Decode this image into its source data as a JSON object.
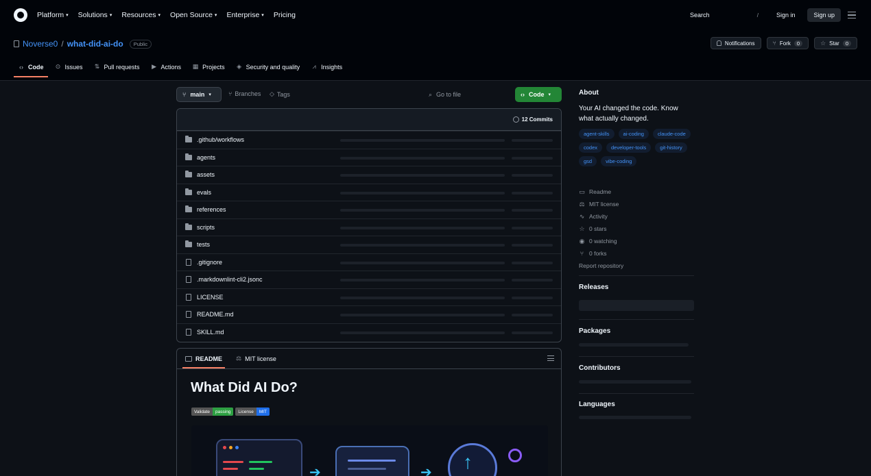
{
  "topnav": {
    "items": [
      {
        "label": "Platform",
        "has_caret": true
      },
      {
        "label": "Solutions",
        "has_caret": true
      },
      {
        "label": "Resources",
        "has_caret": true
      },
      {
        "label": "Open Source",
        "has_caret": true
      },
      {
        "label": "Enterprise",
        "has_caret": true
      },
      {
        "label": "Pricing",
        "has_caret": false
      }
    ],
    "search_label": "Search",
    "search_shortcut": "/",
    "signin_label": "Sign in",
    "signup_label": "Sign up"
  },
  "repo": {
    "owner": "Noverse0",
    "separator": "/",
    "name": "what-did-ai-do",
    "visibility": "Public",
    "notifications_label": "Notifications",
    "fork_label": "Fork",
    "fork_count": "0",
    "star_label": "Star",
    "star_count": "0"
  },
  "repo_tabs": [
    {
      "label": "Code",
      "icon": "code-icon",
      "active": true
    },
    {
      "label": "Issues",
      "icon": "issue-icon",
      "active": false
    },
    {
      "label": "Pull requests",
      "icon": "pull-request-icon",
      "active": false
    },
    {
      "label": "Actions",
      "icon": "play-icon",
      "active": false
    },
    {
      "label": "Projects",
      "icon": "table-icon",
      "active": false
    },
    {
      "label": "Security and quality",
      "icon": "shield-icon",
      "active": false
    },
    {
      "label": "Insights",
      "icon": "graph-icon",
      "active": false
    }
  ],
  "toolbar": {
    "branch": "main",
    "branches_label": "Branches",
    "tags_label": "Tags",
    "goto_placeholder": "Go to file",
    "code_label": "Code"
  },
  "commits": {
    "label": "12 Commits"
  },
  "files": [
    {
      "name": ".github/workflows",
      "type": "folder"
    },
    {
      "name": "agents",
      "type": "folder"
    },
    {
      "name": "assets",
      "type": "folder"
    },
    {
      "name": "evals",
      "type": "folder"
    },
    {
      "name": "references",
      "type": "folder"
    },
    {
      "name": "scripts",
      "type": "folder"
    },
    {
      "name": "tests",
      "type": "folder"
    },
    {
      "name": ".gitignore",
      "type": "file"
    },
    {
      "name": ".markdownlint-cli2.jsonc",
      "type": "file"
    },
    {
      "name": "LICENSE",
      "type": "file"
    },
    {
      "name": "README.md",
      "type": "file"
    },
    {
      "name": "SKILL.md",
      "type": "file"
    }
  ],
  "readme": {
    "tab_readme": "README",
    "tab_license": "MIT license",
    "title": "What Did AI Do?",
    "badges": [
      {
        "left": "Validate",
        "right": "passing",
        "color": "#2ea043"
      },
      {
        "left": "License",
        "right": "MIT",
        "color": "#1f6feb"
      }
    ]
  },
  "about": {
    "heading": "About",
    "description": "Your AI changed the code. Know what actually changed.",
    "topics": [
      "agent-skills",
      "ai-coding",
      "claude-code",
      "codex",
      "developer-tools",
      "git-history",
      "gsd",
      "vibe-coding"
    ],
    "meta": [
      {
        "label": "Readme",
        "icon": "book-icon"
      },
      {
        "label": "MIT license",
        "icon": "law-icon"
      },
      {
        "label": "Activity",
        "icon": "pulse-icon"
      },
      {
        "label": "0 stars",
        "icon": "star-icon"
      },
      {
        "label": "0 watching",
        "icon": "eye-icon"
      },
      {
        "label": "0 forks",
        "icon": "fork-icon"
      }
    ],
    "report_label": "Report repository"
  },
  "sidebar_sections": {
    "releases": "Releases",
    "packages": "Packages",
    "contributors": "Contributors",
    "languages": "Languages"
  },
  "colors": {
    "background": "#0d1117",
    "header": "#010409",
    "accent_link": "#4493f8",
    "code_button": "#238636",
    "active_tab_underline": "#f78166"
  }
}
